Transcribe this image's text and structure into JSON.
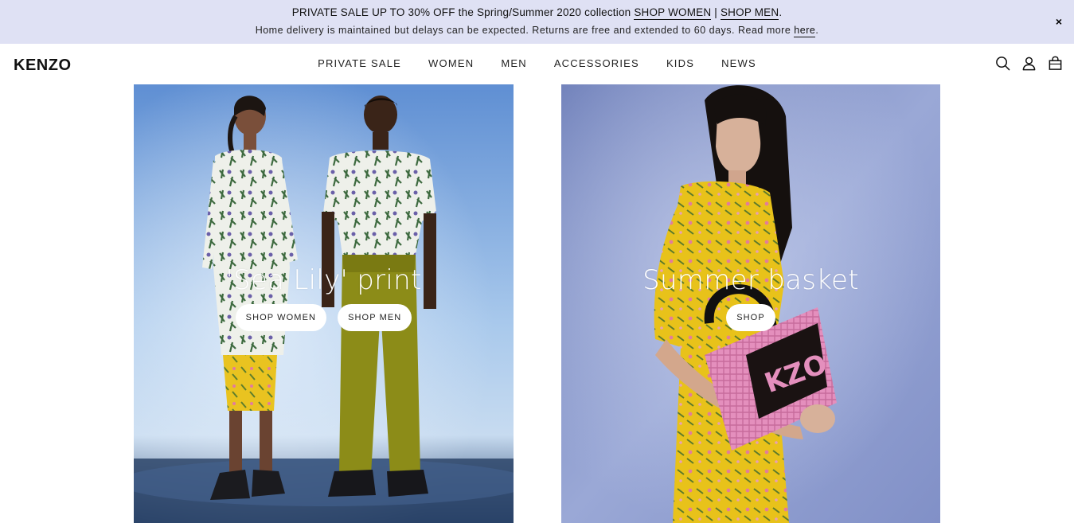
{
  "promo": {
    "line1_prefix": "PRIVATE SALE UP TO 30% OFF the Spring/Summer 2020 collection",
    "shop_women": "SHOP WOMEN",
    "separator": "|",
    "shop_men": "SHOP MEN",
    "period": ".",
    "line2_prefix": "Home delivery is maintained but delays can be expected. Returns are free and extended to 60 days. Read more",
    "here": "here",
    "line2_suffix": ".",
    "close": "×"
  },
  "header": {
    "logo": "KENZO",
    "nav": [
      "PRIVATE SALE",
      "WOMEN",
      "MEN",
      "ACCESSORIES",
      "KIDS",
      "NEWS"
    ],
    "icons": [
      "search-icon",
      "account-icon",
      "bag-icon"
    ]
  },
  "tiles": [
    {
      "title": "'Sea Lily' print",
      "buttons": [
        "SHOP WOMEN",
        "SHOP MEN"
      ]
    },
    {
      "title": "Summer basket",
      "buttons": [
        "SHOP"
      ]
    }
  ],
  "colors": {
    "banner_bg": "#dfe1f4",
    "text": "#1a1a1a",
    "tile_left_sky": "#6f9fd9",
    "tile_right_bg": "#7d8cc4",
    "dress_yellow": "#e8c21a",
    "bag_pink": "#e07fb3"
  }
}
